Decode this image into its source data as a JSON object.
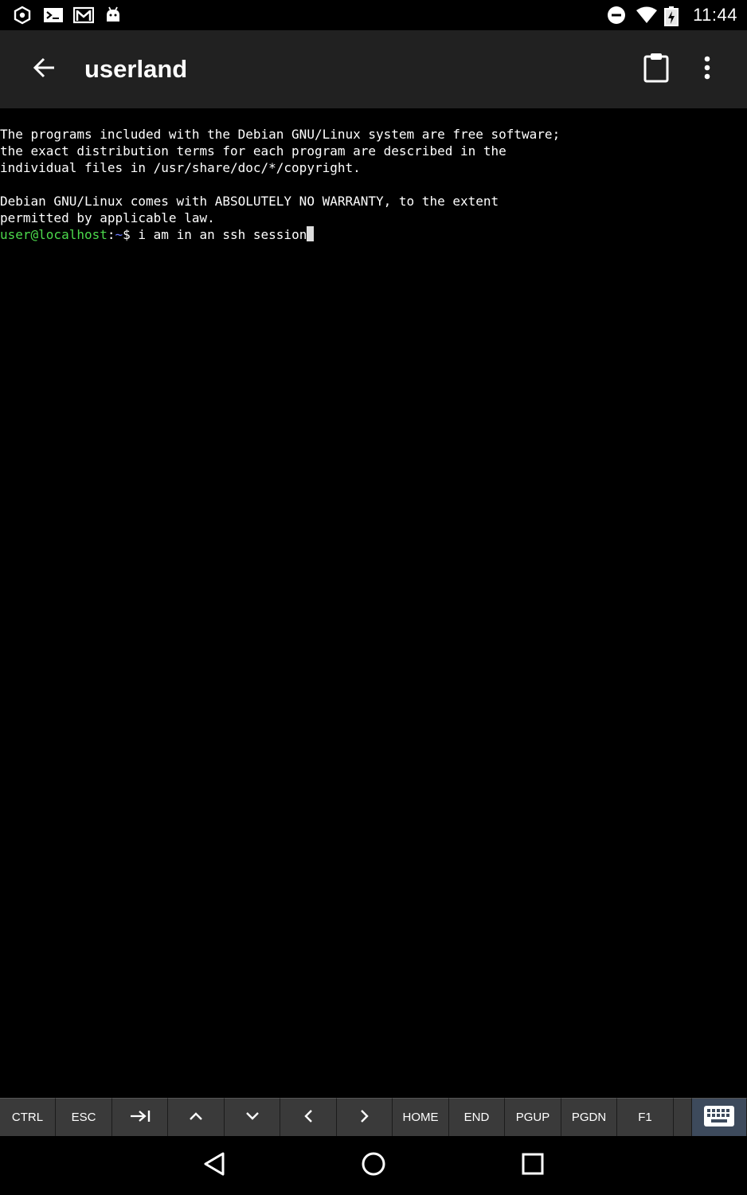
{
  "status_bar": {
    "time": "11:44",
    "left_icons": [
      "userland-icon",
      "terminal-icon",
      "gmail-icon",
      "android-icon"
    ],
    "right_icons": [
      "do-not-disturb-icon",
      "wifi-icon",
      "battery-charging-icon"
    ]
  },
  "app_bar": {
    "title": "userland"
  },
  "terminal": {
    "lines": [
      "The programs included with the Debian GNU/Linux system are free software;",
      "the exact distribution terms for each program are described in the",
      "individual files in /usr/share/doc/*/copyright.",
      "",
      "Debian GNU/Linux comes with ABSOLUTELY NO WARRANTY, to the extent",
      "permitted by applicable law."
    ],
    "prompt": {
      "user_host": "user@localhost",
      "separator": ":",
      "path": "~",
      "symbol": "$ ",
      "command": "i am in an ssh session"
    }
  },
  "extra_keys": {
    "ctrl": "CTRL",
    "esc": "ESC",
    "home": "HOME",
    "end": "END",
    "pgup": "PGUP",
    "pgdn": "PGDN",
    "f1": "F1"
  },
  "colors": {
    "app_bar_bg": "#212121",
    "prompt_user": "#4cd94c",
    "prompt_path": "#6c7bff",
    "extra_keys_bg": "#3a3a3a"
  }
}
